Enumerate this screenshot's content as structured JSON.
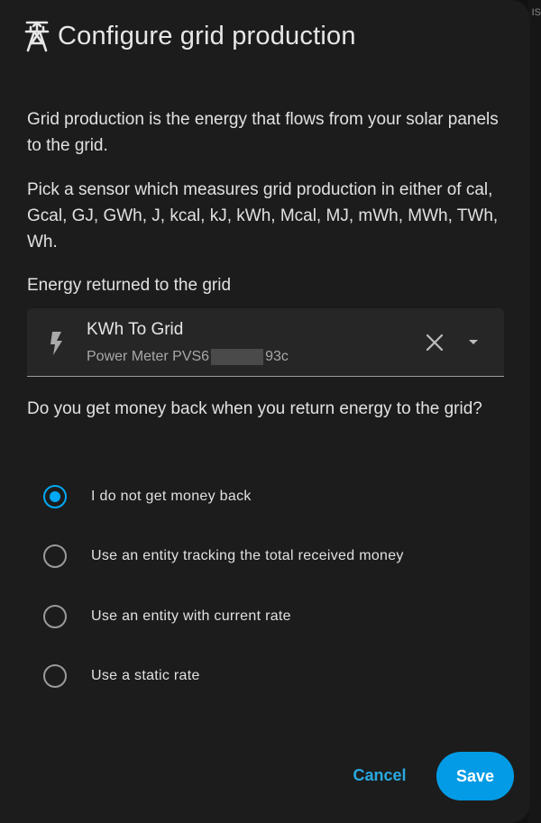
{
  "dialog": {
    "title": "Configure grid production",
    "title_icon": "transmission-tower-export-icon",
    "description": "Grid production is the energy that flows from your solar panels to the grid.",
    "units_text": "Pick a sensor which measures grid production in either of cal, Gcal, GJ, GWh, J, kcal, kJ, kWh, Mcal, MJ, mWh, MWh, TWh, Wh.",
    "field_label": "Energy returned to the grid",
    "entity_picker": {
      "icon": "lightning-bolt-icon",
      "name": "KWh To Grid",
      "device_prefix": "Power Meter PVS6",
      "device_suffix": "93c",
      "clear_icon": "close-icon",
      "dropdown_icon": "menu-down-icon"
    },
    "question": "Do you get money back when you return energy to the grid?",
    "options": [
      {
        "label": "I do not get money back",
        "checked": true
      },
      {
        "label": "Use an entity tracking the total received money",
        "checked": false
      },
      {
        "label": "Use an entity with current rate",
        "checked": false
      },
      {
        "label": "Use a static rate",
        "checked": false
      }
    ],
    "cancel_label": "Cancel",
    "save_label": "Save"
  },
  "background": {
    "edge_text": "IS"
  },
  "colors": {
    "accent": "#03a9f4",
    "button_primary": "#039be5",
    "surface": "#1c1c1c",
    "field_bg": "#262626"
  }
}
